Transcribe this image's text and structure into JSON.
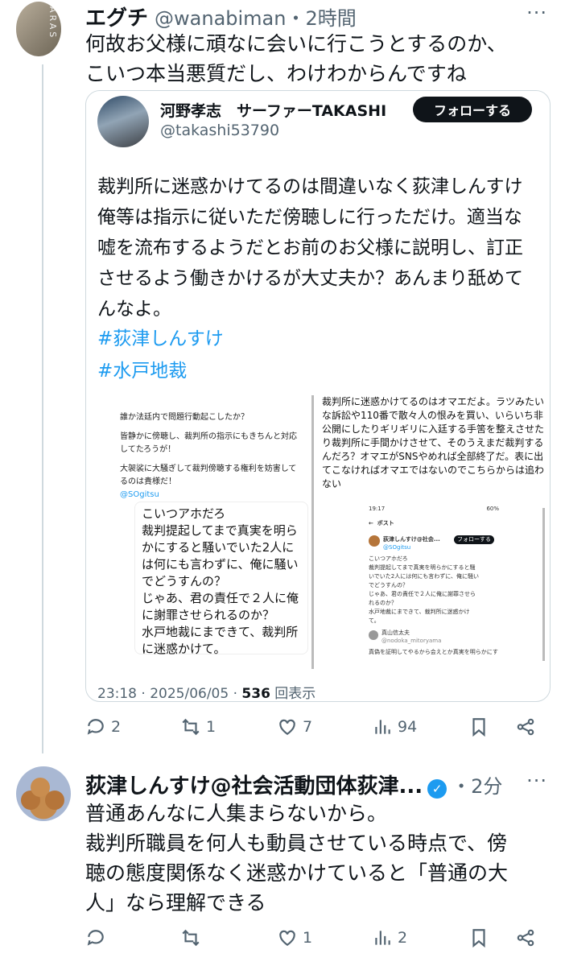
{
  "post1": {
    "name": "エグチ",
    "handle": "@wanabiman",
    "time": "・2時間",
    "more": "···",
    "lines": [
      "何故お父様に頑なに会いに行こうとするのか、",
      "こいつ本当悪質だし、わけわからんですね"
    ]
  },
  "quote": {
    "name": "河野孝志　サーファーTAKASHI",
    "handle": "@takashi53790",
    "follow_label": "フォローする",
    "lines": [
      "裁判所に迷惑かけてるのは間違いなく荻津しんすけ",
      "俺等は指示に従いただ傍聴しに行っただけ。適当な",
      "嘘を流布するようだとお前のお父様に説明し、訂正",
      "させるよう働きかけるが大丈夫か？あんまり舐めて",
      "んなよ。"
    ],
    "hashtags": [
      "#荻津しんすけ",
      "#水戸地裁"
    ],
    "left_shot": {
      "lines": [
        "誰か法廷内で問題行動起こしたか？",
        "",
        "皆静かに傍聴し、裁判所の指示にもきちんと対応",
        "してたろうが！",
        "",
        "大袈裟に大騒ぎして裁判傍聴する権利を妨害して",
        "るのは貴様だ！",
        "@SOgitsu"
      ],
      "reply_lines": [
        "こいつアホだろ",
        "裁判提起してまで真実を明ら",
        "かにすると騒いでいた2人に",
        "は何にも言わずに、俺に騒い",
        "でどうすんの？",
        "じゃあ、君の責任で２人に俺",
        "に謝罪させられるのか？",
        "水戸地裁にまできて、裁判所",
        "に迷惑かけて。"
      ]
    },
    "right_shot": {
      "lines": [
        "裁判所に迷惑かけてるのはオマエだよ。ラツみたい",
        "な訴訟や110番で散々人の恨みを買い、いらいち非",
        "公開にしたりギリギリに入廷する手筈を整えさせた",
        "り裁判所に手間かけさせて、そのうえまだ裁判する",
        "んだろ？オマエがSNSやめれば全部終了だ。表に出",
        "てこなければオマエではないのでこちらからは追わ",
        "ない"
      ],
      "status_time": "19:17",
      "status_right": "60%",
      "back_label": "ポスト",
      "inner_name": "荻津しんすけ@社会...",
      "inner_follow": "フォローする",
      "inner_handle": "@SOgitsu",
      "inner_lines": [
        "こいつアホだろ",
        "裁判提起してまで真実を明らかにすると騒",
        "いでいた2人には何にも言わずに、俺に騒い",
        "でどうすんの？",
        "じゃあ、君の責任で２人に俺に謝罪させら",
        "れるのか？",
        "水戸地裁にまできて、裁判所に迷惑かけ",
        "て。"
      ],
      "reply_name": "真山信太夫",
      "reply_handle": "@nodoka_mitoryama",
      "reply_text": "真偽を証明してやるから会えとか真実を明らかにす"
    },
    "meta_time": "23:18 · 2025/06/05 · ",
    "meta_views": "536",
    "meta_views_label": " 回表示"
  },
  "post1_actions": {
    "replies": "2",
    "reposts": "1",
    "likes": "7",
    "views": "94"
  },
  "post2": {
    "name": "荻津しんすけ@社会活動団体荻津...",
    "handle": "・2分",
    "more": "···",
    "verified_glyph": "✓",
    "lines": [
      "普通あんなに人集まらないから。",
      "裁判所職員を何人も動員させている時点で、傍",
      "聴の態度関係なく迷惑かけていると「普通の大",
      "人」なら理解できる"
    ]
  },
  "post2_actions": {
    "replies": "",
    "reposts": "",
    "likes": "1",
    "views": "2"
  }
}
